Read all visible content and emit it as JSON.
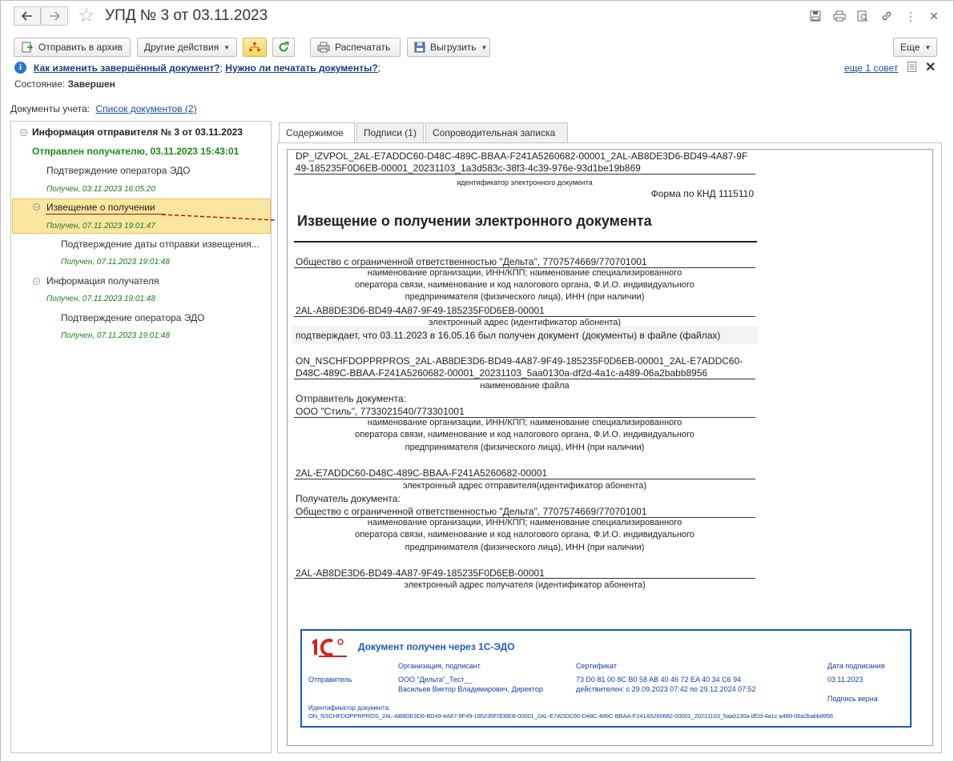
{
  "window": {
    "title": "УПД № 3 от 03.11.2023"
  },
  "toolbar": {
    "send_archive": "Отправить в архив",
    "other_actions": "Другие действия",
    "print": "Распечатать",
    "export": "Выгрузить",
    "more": "Еще"
  },
  "tips": {
    "tip1": "Как изменить завершённый документ?",
    "tip2": "Нужно ли печатать документы?",
    "sep": ";",
    "more_tips": "еще 1 совет"
  },
  "status": {
    "label": "Состояние:",
    "value": "Завершен"
  },
  "docs": {
    "label": "Документы учета:",
    "link": "Список документов (2)"
  },
  "tree": [
    {
      "text": "Информация отправителя № 3 от 03.11.2023"
    },
    {
      "text": "Отправлен получателю, 03.11.2023 15:43:01"
    },
    {
      "text": "Подтверждение оператора ЭДО"
    },
    {
      "text": "Получен, 03.11.2023 16:05:20"
    },
    {
      "text": "Извещение о получении"
    },
    {
      "text": "Получен, 07.11.2023 19:01:47"
    },
    {
      "text": "Подтверждение даты отправки извещения..."
    },
    {
      "text": "Получен, 07.11.2023 19:01:48"
    },
    {
      "text": "Информация получателя"
    },
    {
      "text": "Получен, 07.11.2023 19:01:48"
    },
    {
      "text": "Подтверждение оператора ЭДО"
    },
    {
      "text": "Получен, 07.11.2023 19:01:48"
    }
  ],
  "tabs": [
    "Содержимое",
    "Подписи (1)",
    "Сопроводительная записка"
  ],
  "doc": {
    "id_line1": "DP_IZVPOL_2AL-E7ADDC60-D48C-489C-BBAA-F241A5260682-00001_2AL-AB8DE3D6-BD49-4A87-9F",
    "id_line2": "49-185235F0D6EB-00001_20231103_1a3d583c-38f3-4c39-976e-93d1be19b869",
    "id_caption": "идентификатор электронного документа",
    "form": "Форма по КНД 1115110",
    "heading": "Извещение о получении электронного документа",
    "org1": "Общество с ограниченной ответственностью \"Дельта\", 7707574669/770701001",
    "org_caption_1": "наименование организации, ИНН/КПП; наименование специализированного",
    "org_caption_2": "оператора связи, наименование и код налогового органа, Ф.И.О. индивидуального",
    "org_caption_3": "предпринимателя (физического лица), ИНН (при наличии)",
    "addr1": "2AL-AB8DE3D6-BD49-4A87-9F49-185235F0D6EB-00001",
    "addr1_caption": "электронный адрес (идентификатор абонента)",
    "confirm": "подтверждает, что 03.11.2023 в 16.05.16 был получен документ (документы) в файле (файлах)",
    "file_line1": "ON_NSCHFDOPPRPROS_2AL-AB8DE3D6-BD49-4A87-9F49-185235F0D6EB-00001_2AL-E7ADDC60-",
    "file_line2": "D48C-489C-BBAA-F241A5260682-00001_20231103_5aa0130a-df2d-4a1c-a489-06a2babb8956",
    "file_caption": "наименование файла",
    "sender_label": "Отправитель документа:",
    "sender": "ООО \"Стиль\", 7733021540/773301001",
    "sender_addr": "2AL-E7ADDC60-D48C-489C-BBAA-F241A5260682-00001",
    "sender_addr_caption": "электронный адрес отправителя(идентификатор абонента)",
    "recipient_label": "Получатель документа:",
    "recipient": "Общество с ограниченной ответственностью \"Дельта\", 7707574669/770701001",
    "recipient_addr": "2AL-AB8DE3D6-BD49-4A87-9F49-185235F0D6EB-00001",
    "recipient_addr_caption": "электронный адрес получателя (идентификатор абонента)"
  },
  "stamp": {
    "logo": "1С",
    "title": "Документ получен через 1С-ЭДО",
    "col_org": "Организация, подписант",
    "col_cert": "Сертификат",
    "col_date": "Дата подписания",
    "role": "Отправитель",
    "org": "ООО \"Дельта\"_Тест__",
    "signer": "Васильев Виктор Владимирович, Директор",
    "cert": "73 D0 81 00 8C B0 58 AB 40 46 72 EA 40 34 C6 94",
    "valid": "действителен: с 29.09.2023 07:42 по 29.12.2024 07:52",
    "date": "03.11.2023",
    "sig_ok": "Подпись верна",
    "docid_label": "Идентификатор документа:",
    "docid": "ON_NSCHFDOPPRPROS_2AL-AB8DE3D6-BD49-4A87-9F49-185235F0D6EB-00001_2AL-E7ADDC60-D48C-489C-BBAA-F241A5260682-00001_20231103_5aa0130a-df2d-4a1c-a489-06a2babb8956"
  },
  "colors": {
    "accent": "#1a5bbf",
    "highlight": "#fbe6a0",
    "green": "#1a7a1a",
    "arrow": "#c00000"
  }
}
